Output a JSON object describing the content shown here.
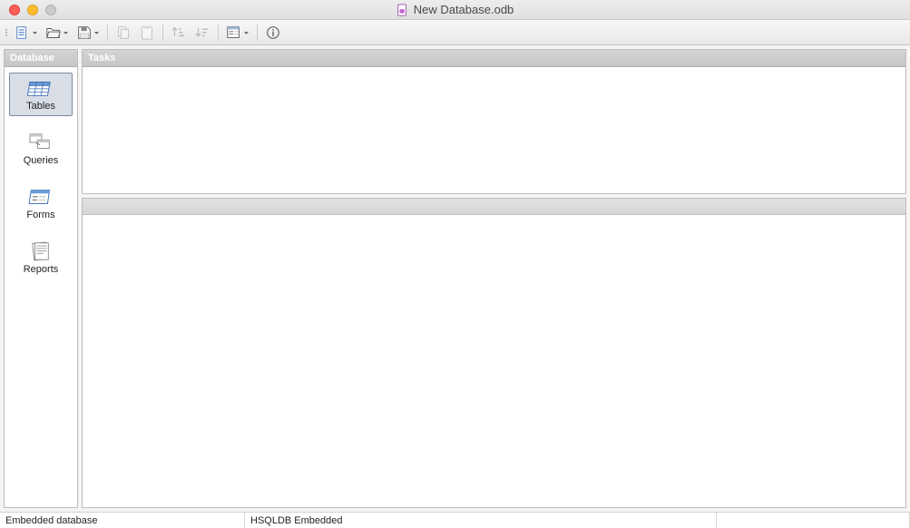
{
  "window": {
    "title": "New Database.odb"
  },
  "sidebar": {
    "header": "Database",
    "items": [
      {
        "label": "Tables"
      },
      {
        "label": "Queries"
      },
      {
        "label": "Forms"
      },
      {
        "label": "Reports"
      }
    ],
    "selected_index": 0
  },
  "tasks": {
    "header": "Tasks"
  },
  "statusbar": {
    "db_type_label": "Embedded database",
    "engine": "HSQLDB Embedded"
  }
}
